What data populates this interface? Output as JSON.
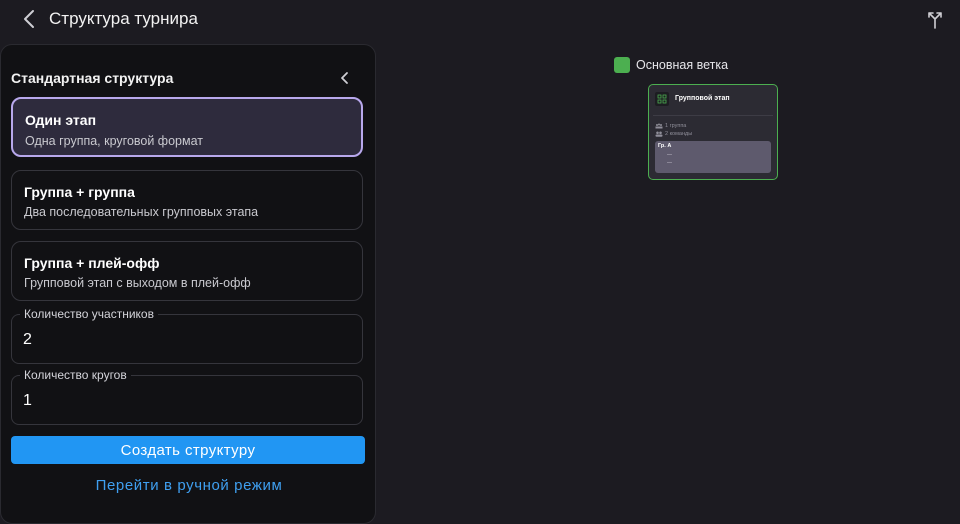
{
  "header": {
    "title": "Структура турнира"
  },
  "panel": {
    "title": "Стандартная структура",
    "options": [
      {
        "title": "Один этап",
        "description": "Одна группа, круговой формат",
        "selected": true
      },
      {
        "title": "Группа + группа",
        "description": "Два последовательных групповых этапа",
        "selected": false
      },
      {
        "title": "Группа + плей-офф",
        "description": "Групповой этап с выходом в плей-офф",
        "selected": false
      }
    ],
    "fields": {
      "participants": {
        "label": "Количество участников",
        "value": "2"
      },
      "rounds": {
        "label": "Количество кругов",
        "value": "1"
      }
    },
    "create_button": "Создать структуру",
    "manual_link": "Перейти в ручной режим"
  },
  "canvas": {
    "legend": {
      "label": "Основная ветка",
      "color": "#4caf50"
    },
    "stage": {
      "title": "Групповой этап",
      "groups_count": "1 группа",
      "teams_count": "2 команды",
      "group": {
        "name": "Гр. А",
        "slots": [
          "—",
          "—"
        ]
      }
    }
  },
  "colors": {
    "accent": "#2196f3",
    "selected_border": "#b8a8ec",
    "branch_green": "#4caf50"
  },
  "icons": [
    "chevron-left-icon",
    "branch-icon",
    "chevron-left-icon",
    "grid-icon",
    "layers-icon",
    "people-icon"
  ]
}
